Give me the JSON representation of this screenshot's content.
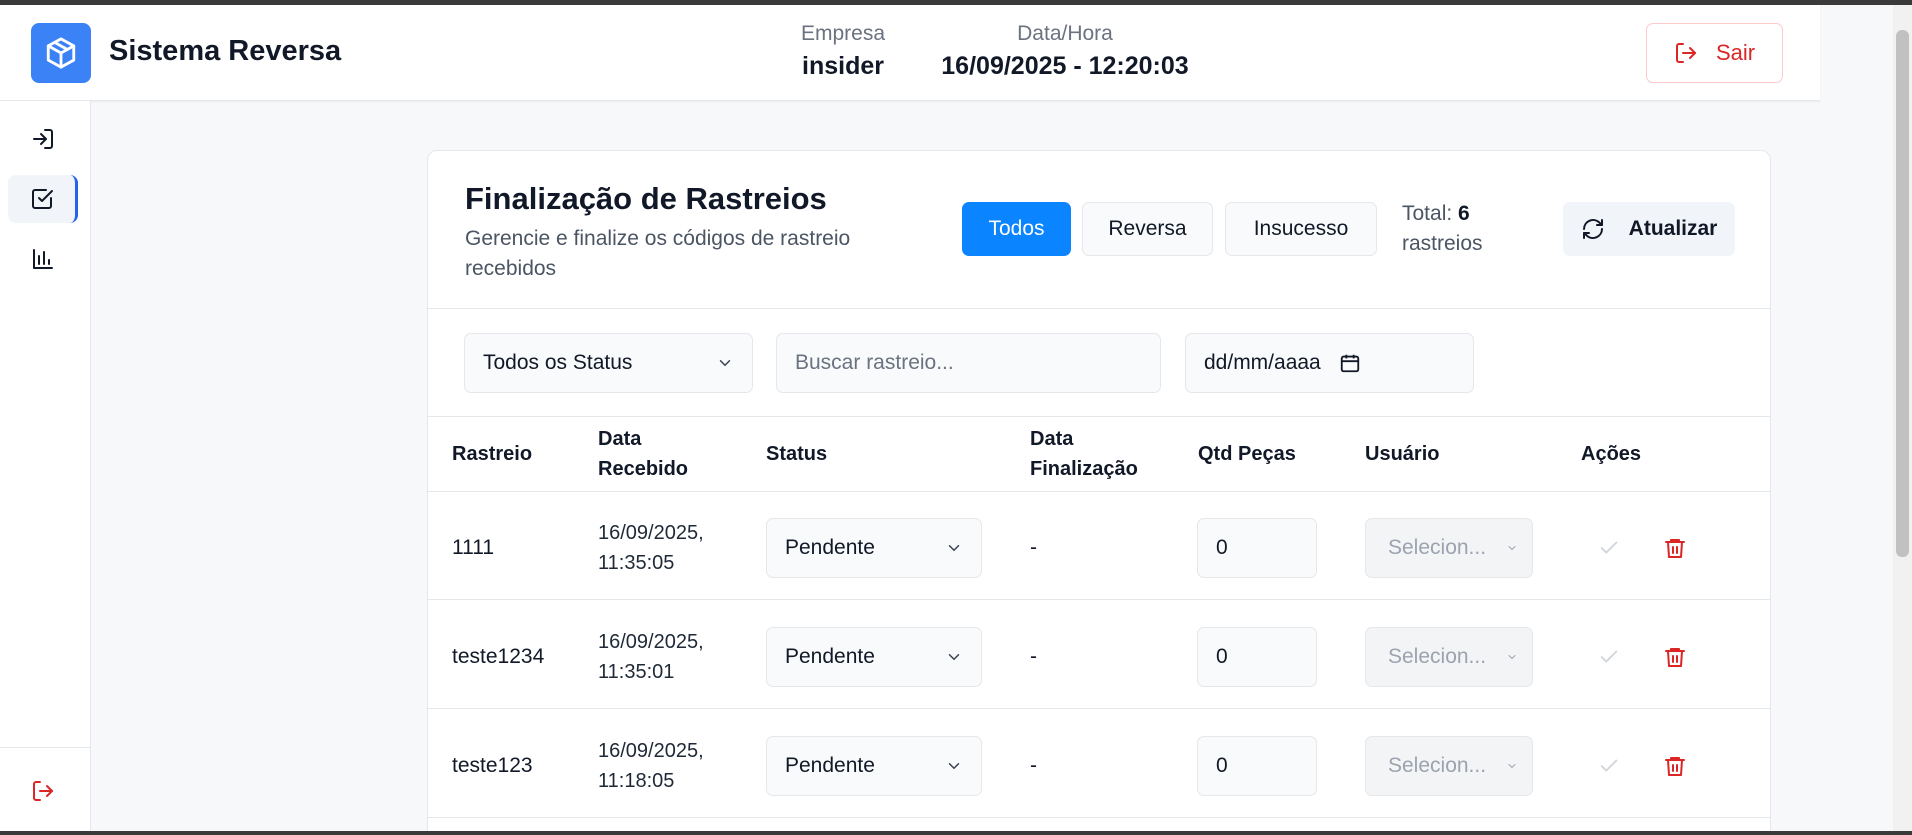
{
  "app": {
    "title": "Sistema Reversa"
  },
  "header": {
    "company_label": "Empresa",
    "company_value": "insider",
    "datetime_label": "Data/Hora",
    "datetime_value": "16/09/2025 - 12:20:03",
    "logout_label": "Sair"
  },
  "sidebar": {
    "items": [
      {
        "icon": "login-icon",
        "active": false
      },
      {
        "icon": "checkbox-icon",
        "active": true
      },
      {
        "icon": "bar-chart-icon",
        "active": false
      }
    ],
    "logout_icon": "logout-icon"
  },
  "page": {
    "title": "Finalização de Rastreios",
    "subtitle": "Gerencie e finalize os códigos de rastreio recebidos",
    "filters": [
      "Todos",
      "Reversa",
      "Insucesso"
    ],
    "active_filter": "Todos",
    "total_label": "Total:",
    "total_count": "6",
    "total_unit": "rastreios",
    "refresh_label": "Atualizar"
  },
  "search": {
    "status_filter": "Todos os Status",
    "placeholder": "Buscar rastreio...",
    "date_placeholder": "dd/mm/aaaa"
  },
  "table": {
    "headers": {
      "rastreio": "Rastreio",
      "data_recebido": "Data Recebido",
      "status": "Status",
      "data_finalizacao": "Data Finalização",
      "qtd_pecas": "Qtd Peças",
      "usuario": "Usuário",
      "acoes": "Ações"
    },
    "rows": [
      {
        "rastreio": "1111",
        "date_line1": "16/09/2025,",
        "date_line2": "11:35:05",
        "status": "Pendente",
        "finalizacao": "-",
        "qtd": "0",
        "usuario": "Selecion..."
      },
      {
        "rastreio": "teste1234",
        "date_line1": "16/09/2025,",
        "date_line2": "11:35:01",
        "status": "Pendente",
        "finalizacao": "-",
        "qtd": "0",
        "usuario": "Selecion..."
      },
      {
        "rastreio": "teste123",
        "date_line1": "16/09/2025,",
        "date_line2": "11:18:05",
        "status": "Pendente",
        "finalizacao": "-",
        "qtd": "0",
        "usuario": "Selecion..."
      }
    ]
  },
  "colors": {
    "accent": "#0a84ff",
    "brand": "#3b82f6",
    "danger": "#dc2626"
  }
}
